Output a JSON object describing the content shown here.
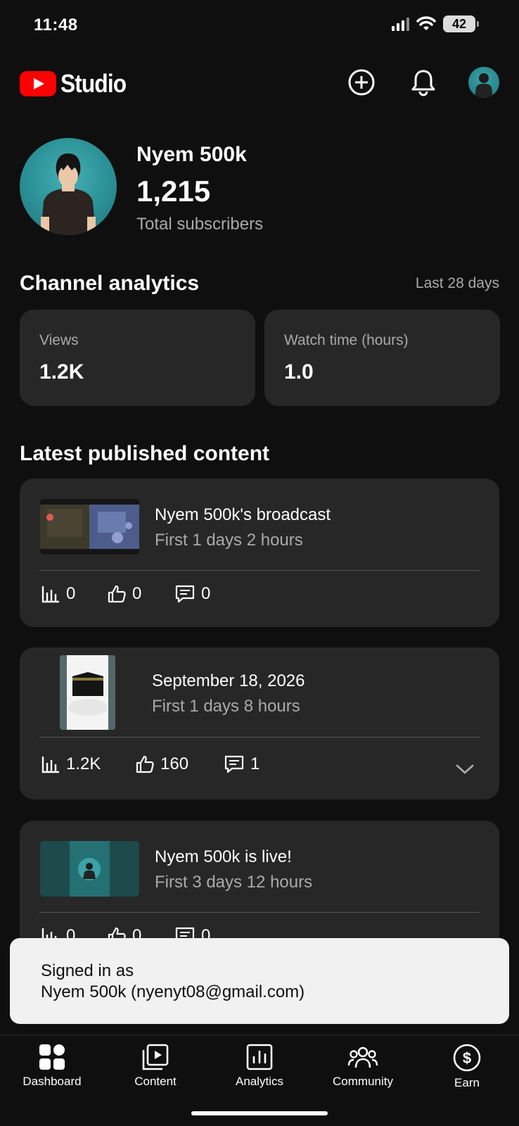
{
  "status_bar": {
    "time": "11:48",
    "battery": "42"
  },
  "app_bar": {
    "logo_text": "Studio",
    "icons": [
      "youtube-play-icon",
      "create-plus-icon",
      "notifications-bell-icon",
      "account-avatar"
    ]
  },
  "channel": {
    "name": "Nyem 500k",
    "subscribers": "1,215",
    "subscribers_label": "Total subscribers"
  },
  "analytics": {
    "title": "Channel analytics",
    "period": "Last 28 days",
    "metrics": [
      {
        "label": "Views",
        "value": "1.2K"
      },
      {
        "label": "Watch time (hours)",
        "value": "1.0"
      }
    ]
  },
  "latest": {
    "title": "Latest published content",
    "items": [
      {
        "title": "Nyem 500k's broadcast",
        "subtitle": "First 1 days 2 hours",
        "views": "0",
        "likes": "0",
        "comments": "0"
      },
      {
        "title": "September 18, 2026",
        "subtitle": "First 1 days 8 hours",
        "views": "1.2K",
        "likes": "160",
        "comments": "1"
      },
      {
        "title": "Nyem 500k is live!",
        "subtitle": "First 3 days 12 hours",
        "views": "0",
        "likes": "0",
        "comments": "0"
      }
    ]
  },
  "toast": {
    "line1": "Signed in as",
    "line2": "Nyem 500k (nyenyt08@gmail.com)"
  },
  "bottom_nav": {
    "items": [
      {
        "label": "Dashboard",
        "icon": "dashboard-icon"
      },
      {
        "label": "Content",
        "icon": "content-icon"
      },
      {
        "label": "Analytics",
        "icon": "analytics-icon"
      },
      {
        "label": "Community",
        "icon": "community-icon"
      },
      {
        "label": "Earn",
        "icon": "earn-icon"
      }
    ]
  },
  "colors": {
    "background": "#0f0f0f",
    "card": "#272727",
    "brand_red": "#ff0000",
    "secondary_text": "#aaaaaa"
  }
}
